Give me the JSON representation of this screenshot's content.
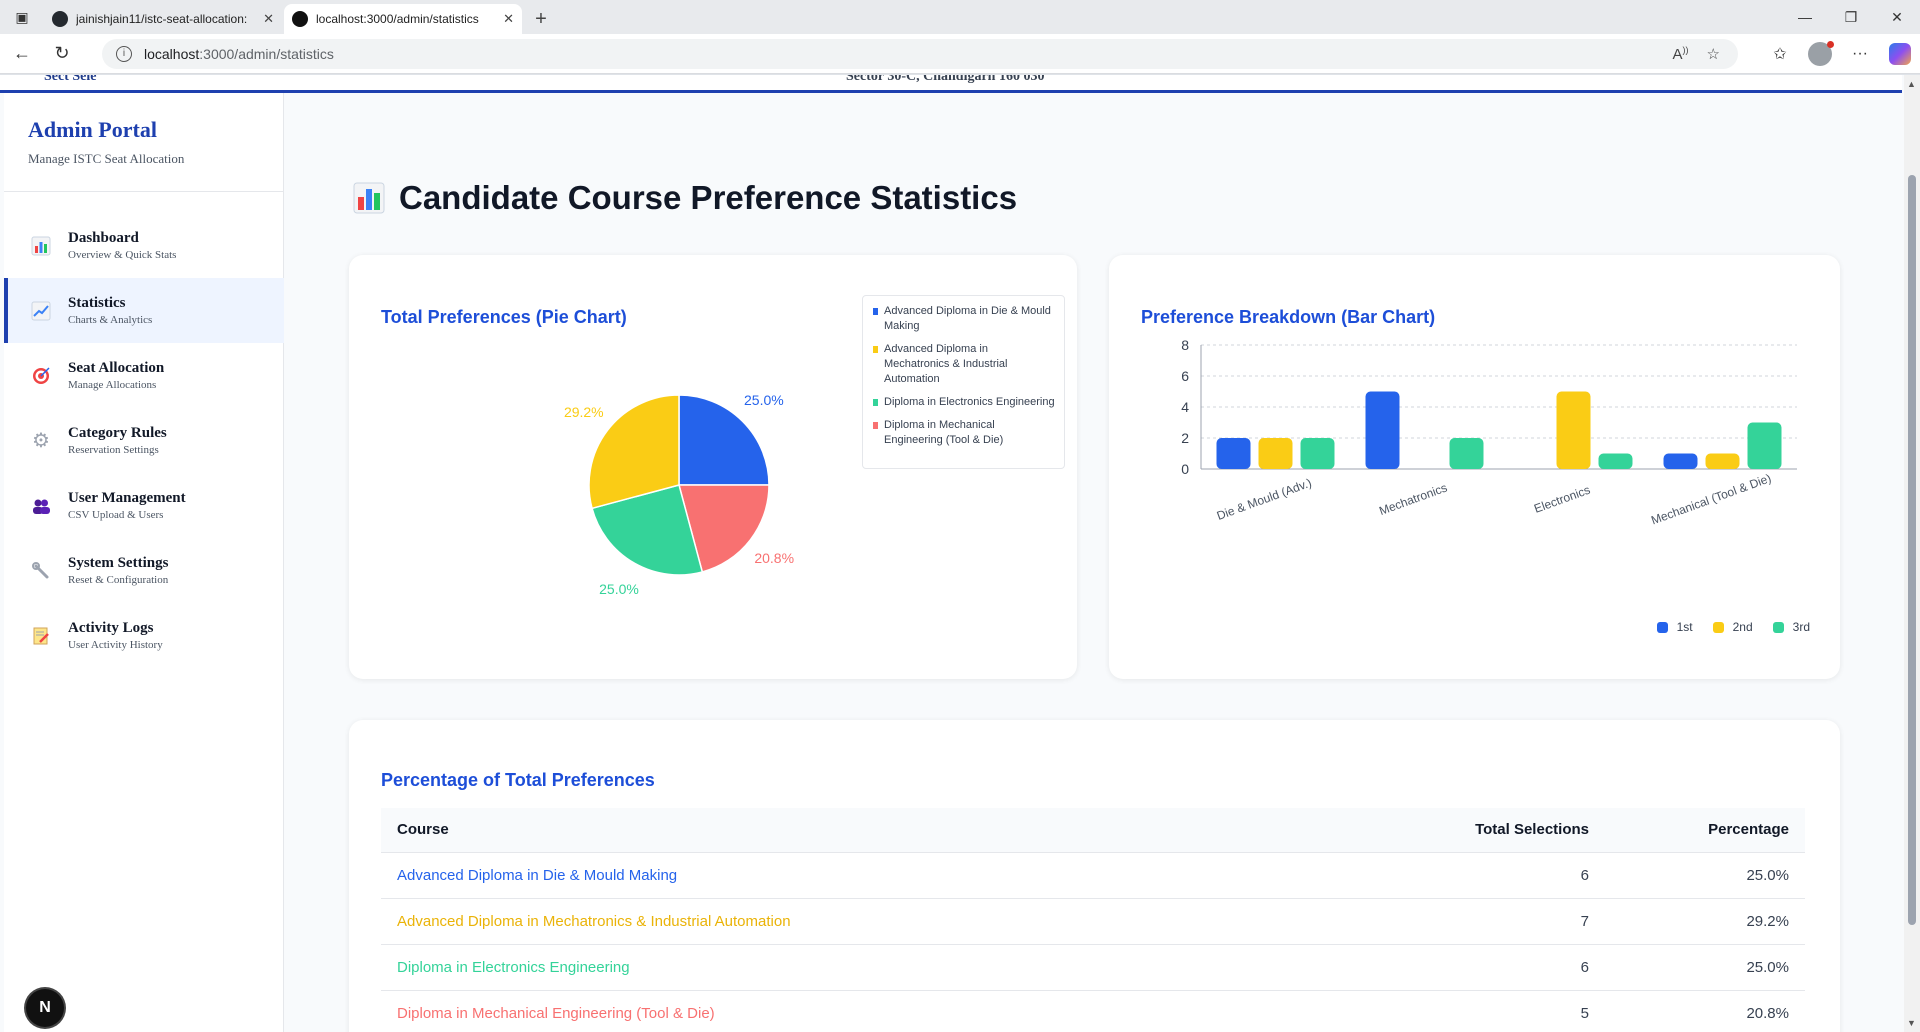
{
  "browser": {
    "tabs": [
      {
        "title": "jainishjain11/istc-seat-allocation:",
        "active": false
      },
      {
        "title": "localhost:3000/admin/statistics",
        "active": true
      }
    ],
    "url_host": "localhost",
    "url_path": ":3000/admin/statistics"
  },
  "header_clip": {
    "left": "Sect Sele",
    "center": "Sector 30-C, Chandigarh 160 030"
  },
  "sidebar": {
    "title": "Admin Portal",
    "subtitle": "Manage ISTC Seat Allocation",
    "items": [
      {
        "label": "Dashboard",
        "sub": "Overview & Quick Stats",
        "icon": "bar-chart-icon",
        "active": false
      },
      {
        "label": "Statistics",
        "sub": "Charts & Analytics",
        "icon": "line-chart-icon",
        "active": true
      },
      {
        "label": "Seat Allocation",
        "sub": "Manage Allocations",
        "icon": "target-icon",
        "active": false
      },
      {
        "label": "Category Rules",
        "sub": "Reservation Settings",
        "icon": "gear-icon",
        "active": false
      },
      {
        "label": "User Management",
        "sub": "CSV Upload & Users",
        "icon": "users-icon",
        "active": false
      },
      {
        "label": "System Settings",
        "sub": "Reset & Configuration",
        "icon": "wrench-icon",
        "active": false
      },
      {
        "label": "Activity Logs",
        "sub": "User Activity History",
        "icon": "memo-icon",
        "active": false
      }
    ],
    "badge": "N"
  },
  "page": {
    "title": "Candidate Course Preference Statistics"
  },
  "colors": {
    "blue": "#2563eb",
    "yellow": "#facc15",
    "green": "#34d399",
    "red": "#f87171"
  },
  "pie_card": {
    "title": "Total Preferences (Pie Chart)"
  },
  "bar_card": {
    "title": "Preference Breakdown (Bar Chart)"
  },
  "chart_data": [
    {
      "type": "pie",
      "title": "Total Preferences (Pie Chart)",
      "categories": [
        "Advanced Diploma in Die & Mould Making",
        "Diploma in Mechanical Engineering (Tool & Die)",
        "Diploma in Electronics Engineering",
        "Advanced Diploma in Mechatronics & Industrial Automation"
      ],
      "values": [
        6,
        5,
        6,
        7
      ],
      "labels": [
        "25.0%",
        "20.8%",
        "25.0%",
        "29.2%"
      ],
      "colors": [
        "#2563eb",
        "#f87171",
        "#34d399",
        "#facc15"
      ],
      "legend": [
        {
          "label": "Advanced Diploma in Die & Mould Making",
          "color": "#2563eb"
        },
        {
          "label": "Advanced Diploma in Mechatronics & Industrial Automation",
          "color": "#facc15"
        },
        {
          "label": "Diploma in Electronics Engineering",
          "color": "#34d399"
        },
        {
          "label": "Diploma in Mechanical Engineering (Tool & Die)",
          "color": "#f87171"
        }
      ],
      "legend_position": "top-right"
    },
    {
      "type": "bar",
      "title": "Preference Breakdown (Bar Chart)",
      "categories": [
        "Die & Mould (Adv.)",
        "Mechatronics",
        "Electronics",
        "Mechanical (Tool & Die)"
      ],
      "series": [
        {
          "name": "1st",
          "color": "#2563eb",
          "values": [
            2,
            5,
            0,
            1
          ]
        },
        {
          "name": "2nd",
          "color": "#facc15",
          "values": [
            2,
            0,
            5,
            1
          ]
        },
        {
          "name": "3rd",
          "color": "#34d399",
          "values": [
            2,
            2,
            1,
            3
          ]
        }
      ],
      "yticks": [
        "0",
        "2",
        "4",
        "6",
        "8"
      ],
      "ylim": [
        0,
        8
      ],
      "grid": true,
      "legend_position": "bottom-right"
    }
  ],
  "table": {
    "title": "Percentage of Total Preferences",
    "headers": {
      "course": "Course",
      "total": "Total Selections",
      "pct": "Percentage"
    },
    "rows": [
      {
        "course": "Advanced Diploma in Die & Mould Making",
        "total": "6",
        "pct": "25.0%",
        "color": "#2563eb"
      },
      {
        "course": "Advanced Diploma in Mechatronics & Industrial Automation",
        "total": "7",
        "pct": "29.2%",
        "color": "#eab308"
      },
      {
        "course": "Diploma in Electronics Engineering",
        "total": "6",
        "pct": "25.0%",
        "color": "#34d399"
      },
      {
        "course": "Diploma in Mechanical Engineering (Tool & Die)",
        "total": "5",
        "pct": "20.8%",
        "color": "#f87171"
      }
    ]
  }
}
